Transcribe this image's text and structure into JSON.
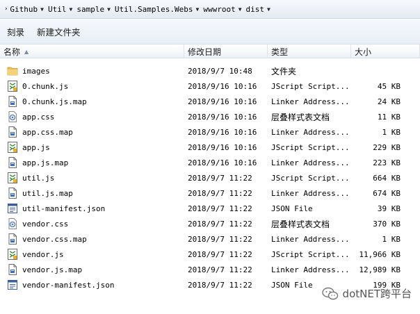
{
  "breadcrumb": [
    {
      "label": "Github"
    },
    {
      "label": "Util"
    },
    {
      "label": "sample"
    },
    {
      "label": "Util.Samples.Webs"
    },
    {
      "label": "wwwroot"
    },
    {
      "label": "dist"
    }
  ],
  "toolbar": {
    "burn_label": "刻录",
    "new_folder_label": "新建文件夹"
  },
  "columns": {
    "name": "名称",
    "date": "修改日期",
    "type": "类型",
    "size": "大小"
  },
  "files": [
    {
      "name": "images",
      "date": "2018/9/7 10:48",
      "type": "文件夹",
      "size": "",
      "icon": "folder-icon"
    },
    {
      "name": "0.chunk.js",
      "date": "2018/9/16 10:16",
      "type": "JScript Script...",
      "size": "45 KB",
      "icon": "jscript-file-icon"
    },
    {
      "name": "0.chunk.js.map",
      "date": "2018/9/16 10:16",
      "type": "Linker Address...",
      "size": "24 KB",
      "icon": "map-file-icon"
    },
    {
      "name": "app.css",
      "date": "2018/9/16 10:16",
      "type": "层叠样式表文档",
      "size": "11 KB",
      "icon": "css-file-icon"
    },
    {
      "name": "app.css.map",
      "date": "2018/9/16 10:16",
      "type": "Linker Address...",
      "size": "1 KB",
      "icon": "map-file-icon"
    },
    {
      "name": "app.js",
      "date": "2018/9/16 10:16",
      "type": "JScript Script...",
      "size": "229 KB",
      "icon": "jscript-file-icon"
    },
    {
      "name": "app.js.map",
      "date": "2018/9/16 10:16",
      "type": "Linker Address...",
      "size": "223 KB",
      "icon": "map-file-icon"
    },
    {
      "name": "util.js",
      "date": "2018/9/7 11:22",
      "type": "JScript Script...",
      "size": "664 KB",
      "icon": "jscript-file-icon"
    },
    {
      "name": "util.js.map",
      "date": "2018/9/7 11:22",
      "type": "Linker Address...",
      "size": "674 KB",
      "icon": "map-file-icon"
    },
    {
      "name": "util-manifest.json",
      "date": "2018/9/7 11:22",
      "type": "JSON File",
      "size": "39 KB",
      "icon": "json-file-icon"
    },
    {
      "name": "vendor.css",
      "date": "2018/9/7 11:22",
      "type": "层叠样式表文档",
      "size": "370 KB",
      "icon": "css-file-icon"
    },
    {
      "name": "vendor.css.map",
      "date": "2018/9/7 11:22",
      "type": "Linker Address...",
      "size": "1 KB",
      "icon": "map-file-icon"
    },
    {
      "name": "vendor.js",
      "date": "2018/9/7 11:22",
      "type": "JScript Script...",
      "size": "11,966 KB",
      "icon": "jscript-file-icon"
    },
    {
      "name": "vendor.js.map",
      "date": "2018/9/7 11:22",
      "type": "Linker Address...",
      "size": "12,989 KB",
      "icon": "map-file-icon"
    },
    {
      "name": "vendor-manifest.json",
      "date": "2018/9/7 11:22",
      "type": "JSON File",
      "size": "199 KB",
      "icon": "json-file-icon"
    }
  ],
  "watermark": {
    "text": "dotNET跨平台"
  }
}
